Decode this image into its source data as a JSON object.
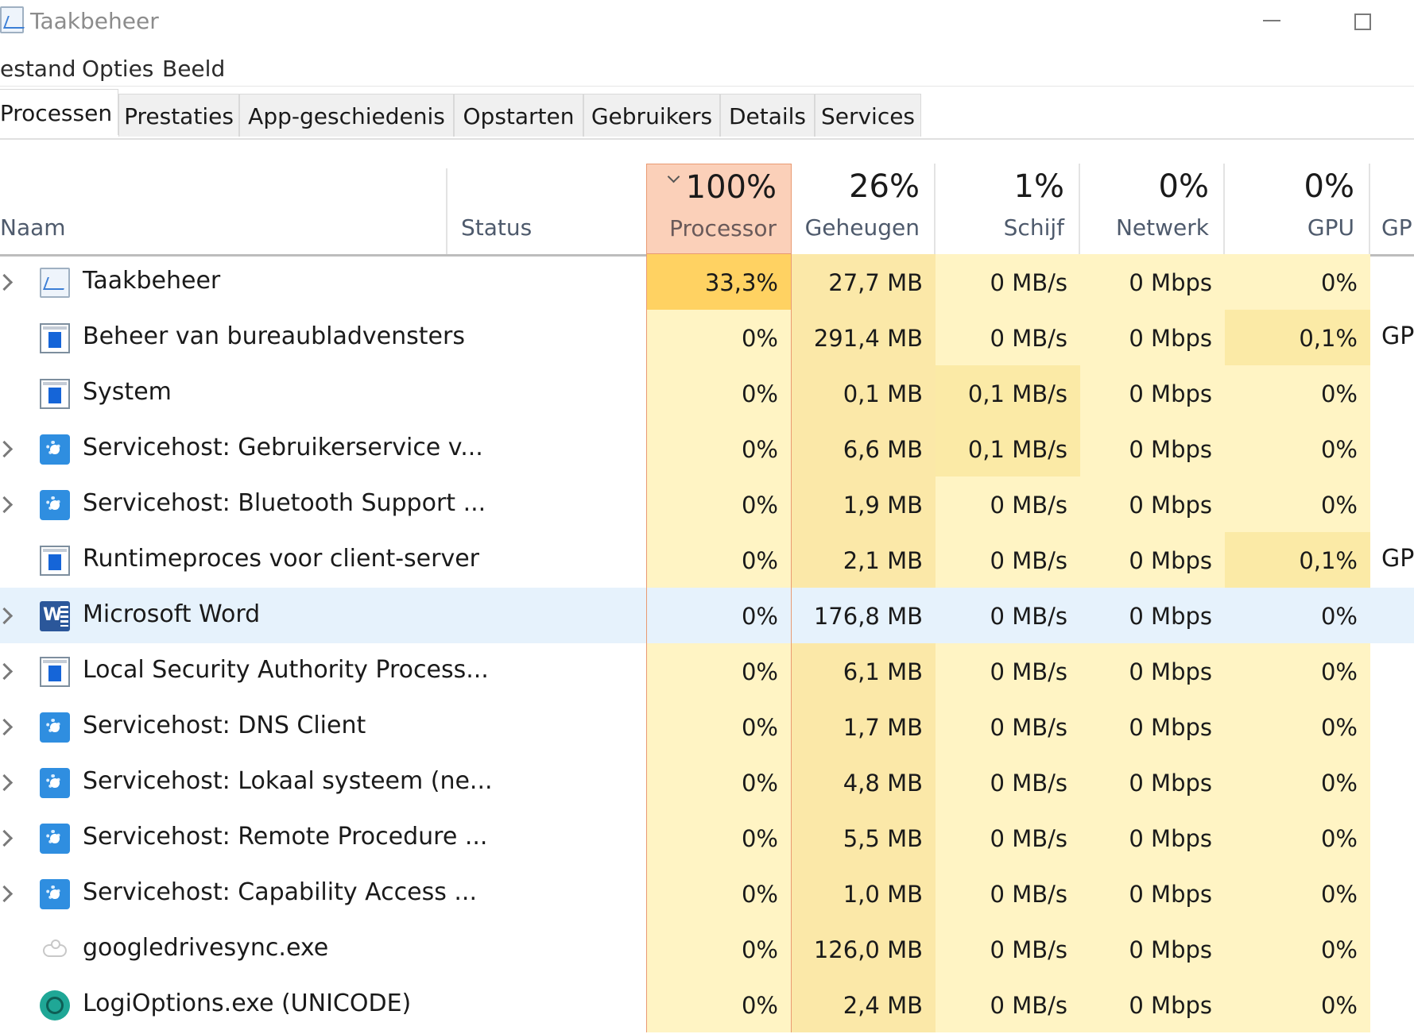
{
  "window": {
    "title": "Taakbeheer",
    "icon": "task-manager-icon"
  },
  "menu": [
    "estand",
    "Opties",
    "Beeld"
  ],
  "tabs": [
    {
      "label": "Processen",
      "active": true
    },
    {
      "label": "Prestaties"
    },
    {
      "label": "App-geschiedenis"
    },
    {
      "label": "Opstarten"
    },
    {
      "label": "Gebruikers"
    },
    {
      "label": "Details"
    },
    {
      "label": "Services"
    }
  ],
  "columns": {
    "name": "Naam",
    "status": "Status",
    "processor": {
      "value": "100%",
      "label": "Processor"
    },
    "memory": {
      "value": "26%",
      "label": "Geheugen"
    },
    "disk": {
      "value": "1%",
      "label": "Schijf"
    },
    "network": {
      "value": "0%",
      "label": "Netwerk"
    },
    "gpu": {
      "value": "0%",
      "label": "GPU"
    },
    "gpu_engine": "GP"
  },
  "colors": {
    "sorted_header": "#fbd0b9",
    "cpu_high": "#ffd262",
    "cell_light": "#fff4c4",
    "cell_mid": "#fbeaa6",
    "cell_mem": "#fbe8a8",
    "selected": "#e6f2fc"
  },
  "processes": [
    {
      "name": "Taakbeheer",
      "icon": "task-manager-icon",
      "expandable": true,
      "cpu": "33,3%",
      "memory": "27,7 MB",
      "disk": "0 MB/s",
      "network": "0 Mbps",
      "gpu": "0%",
      "gpu_engine": ""
    },
    {
      "name": "Beheer van bureaubladvensters",
      "icon": "window-icon",
      "expandable": false,
      "cpu": "0%",
      "memory": "291,4 MB",
      "disk": "0 MB/s",
      "network": "0 Mbps",
      "gpu": "0,1%",
      "gpu_engine": "GP"
    },
    {
      "name": "System",
      "icon": "window-icon",
      "expandable": false,
      "cpu": "0%",
      "memory": "0,1 MB",
      "disk": "0,1 MB/s",
      "network": "0 Mbps",
      "gpu": "0%",
      "gpu_engine": ""
    },
    {
      "name": "Servicehost: Gebruikerservice v...",
      "icon": "gear-icon",
      "expandable": true,
      "cpu": "0%",
      "memory": "6,6 MB",
      "disk": "0,1 MB/s",
      "network": "0 Mbps",
      "gpu": "0%",
      "gpu_engine": ""
    },
    {
      "name": "Servicehost: Bluetooth Support ...",
      "icon": "gear-icon",
      "expandable": true,
      "cpu": "0%",
      "memory": "1,9 MB",
      "disk": "0 MB/s",
      "network": "0 Mbps",
      "gpu": "0%",
      "gpu_engine": ""
    },
    {
      "name": "Runtimeproces voor client-server",
      "icon": "window-icon",
      "expandable": false,
      "cpu": "0%",
      "memory": "2,1 MB",
      "disk": "0 MB/s",
      "network": "0 Mbps",
      "gpu": "0,1%",
      "gpu_engine": "GP"
    },
    {
      "name": "Microsoft Word",
      "icon": "word-icon",
      "expandable": true,
      "selected": true,
      "cpu": "0%",
      "memory": "176,8 MB",
      "disk": "0 MB/s",
      "network": "0 Mbps",
      "gpu": "0%",
      "gpu_engine": ""
    },
    {
      "name": "Local Security Authority Process...",
      "icon": "window-icon",
      "expandable": true,
      "cpu": "0%",
      "memory": "6,1 MB",
      "disk": "0 MB/s",
      "network": "0 Mbps",
      "gpu": "0%",
      "gpu_engine": ""
    },
    {
      "name": "Servicehost: DNS Client",
      "icon": "gear-icon",
      "expandable": true,
      "cpu": "0%",
      "memory": "1,7 MB",
      "disk": "0 MB/s",
      "network": "0 Mbps",
      "gpu": "0%",
      "gpu_engine": ""
    },
    {
      "name": "Servicehost: Lokaal systeem (ne...",
      "icon": "gear-icon",
      "expandable": true,
      "cpu": "0%",
      "memory": "4,8 MB",
      "disk": "0 MB/s",
      "network": "0 Mbps",
      "gpu": "0%",
      "gpu_engine": ""
    },
    {
      "name": "Servicehost: Remote Procedure ...",
      "icon": "gear-icon",
      "expandable": true,
      "cpu": "0%",
      "memory": "5,5 MB",
      "disk": "0 MB/s",
      "network": "0 Mbps",
      "gpu": "0%",
      "gpu_engine": ""
    },
    {
      "name": "Servicehost: Capability Access ...",
      "icon": "gear-icon",
      "expandable": true,
      "cpu": "0%",
      "memory": "1,0 MB",
      "disk": "0 MB/s",
      "network": "0 Mbps",
      "gpu": "0%",
      "gpu_engine": ""
    },
    {
      "name": "googledrivesync.exe",
      "icon": "cloud-icon",
      "expandable": false,
      "cpu": "0%",
      "memory": "126,0 MB",
      "disk": "0 MB/s",
      "network": "0 Mbps",
      "gpu": "0%",
      "gpu_engine": ""
    },
    {
      "name": "LogiOptions.exe (UNICODE)",
      "icon": "logi-icon",
      "expandable": false,
      "cpu": "0%",
      "memory": "2,4 MB",
      "disk": "0 MB/s",
      "network": "0 Mbps",
      "gpu": "0%",
      "gpu_engine": ""
    }
  ]
}
